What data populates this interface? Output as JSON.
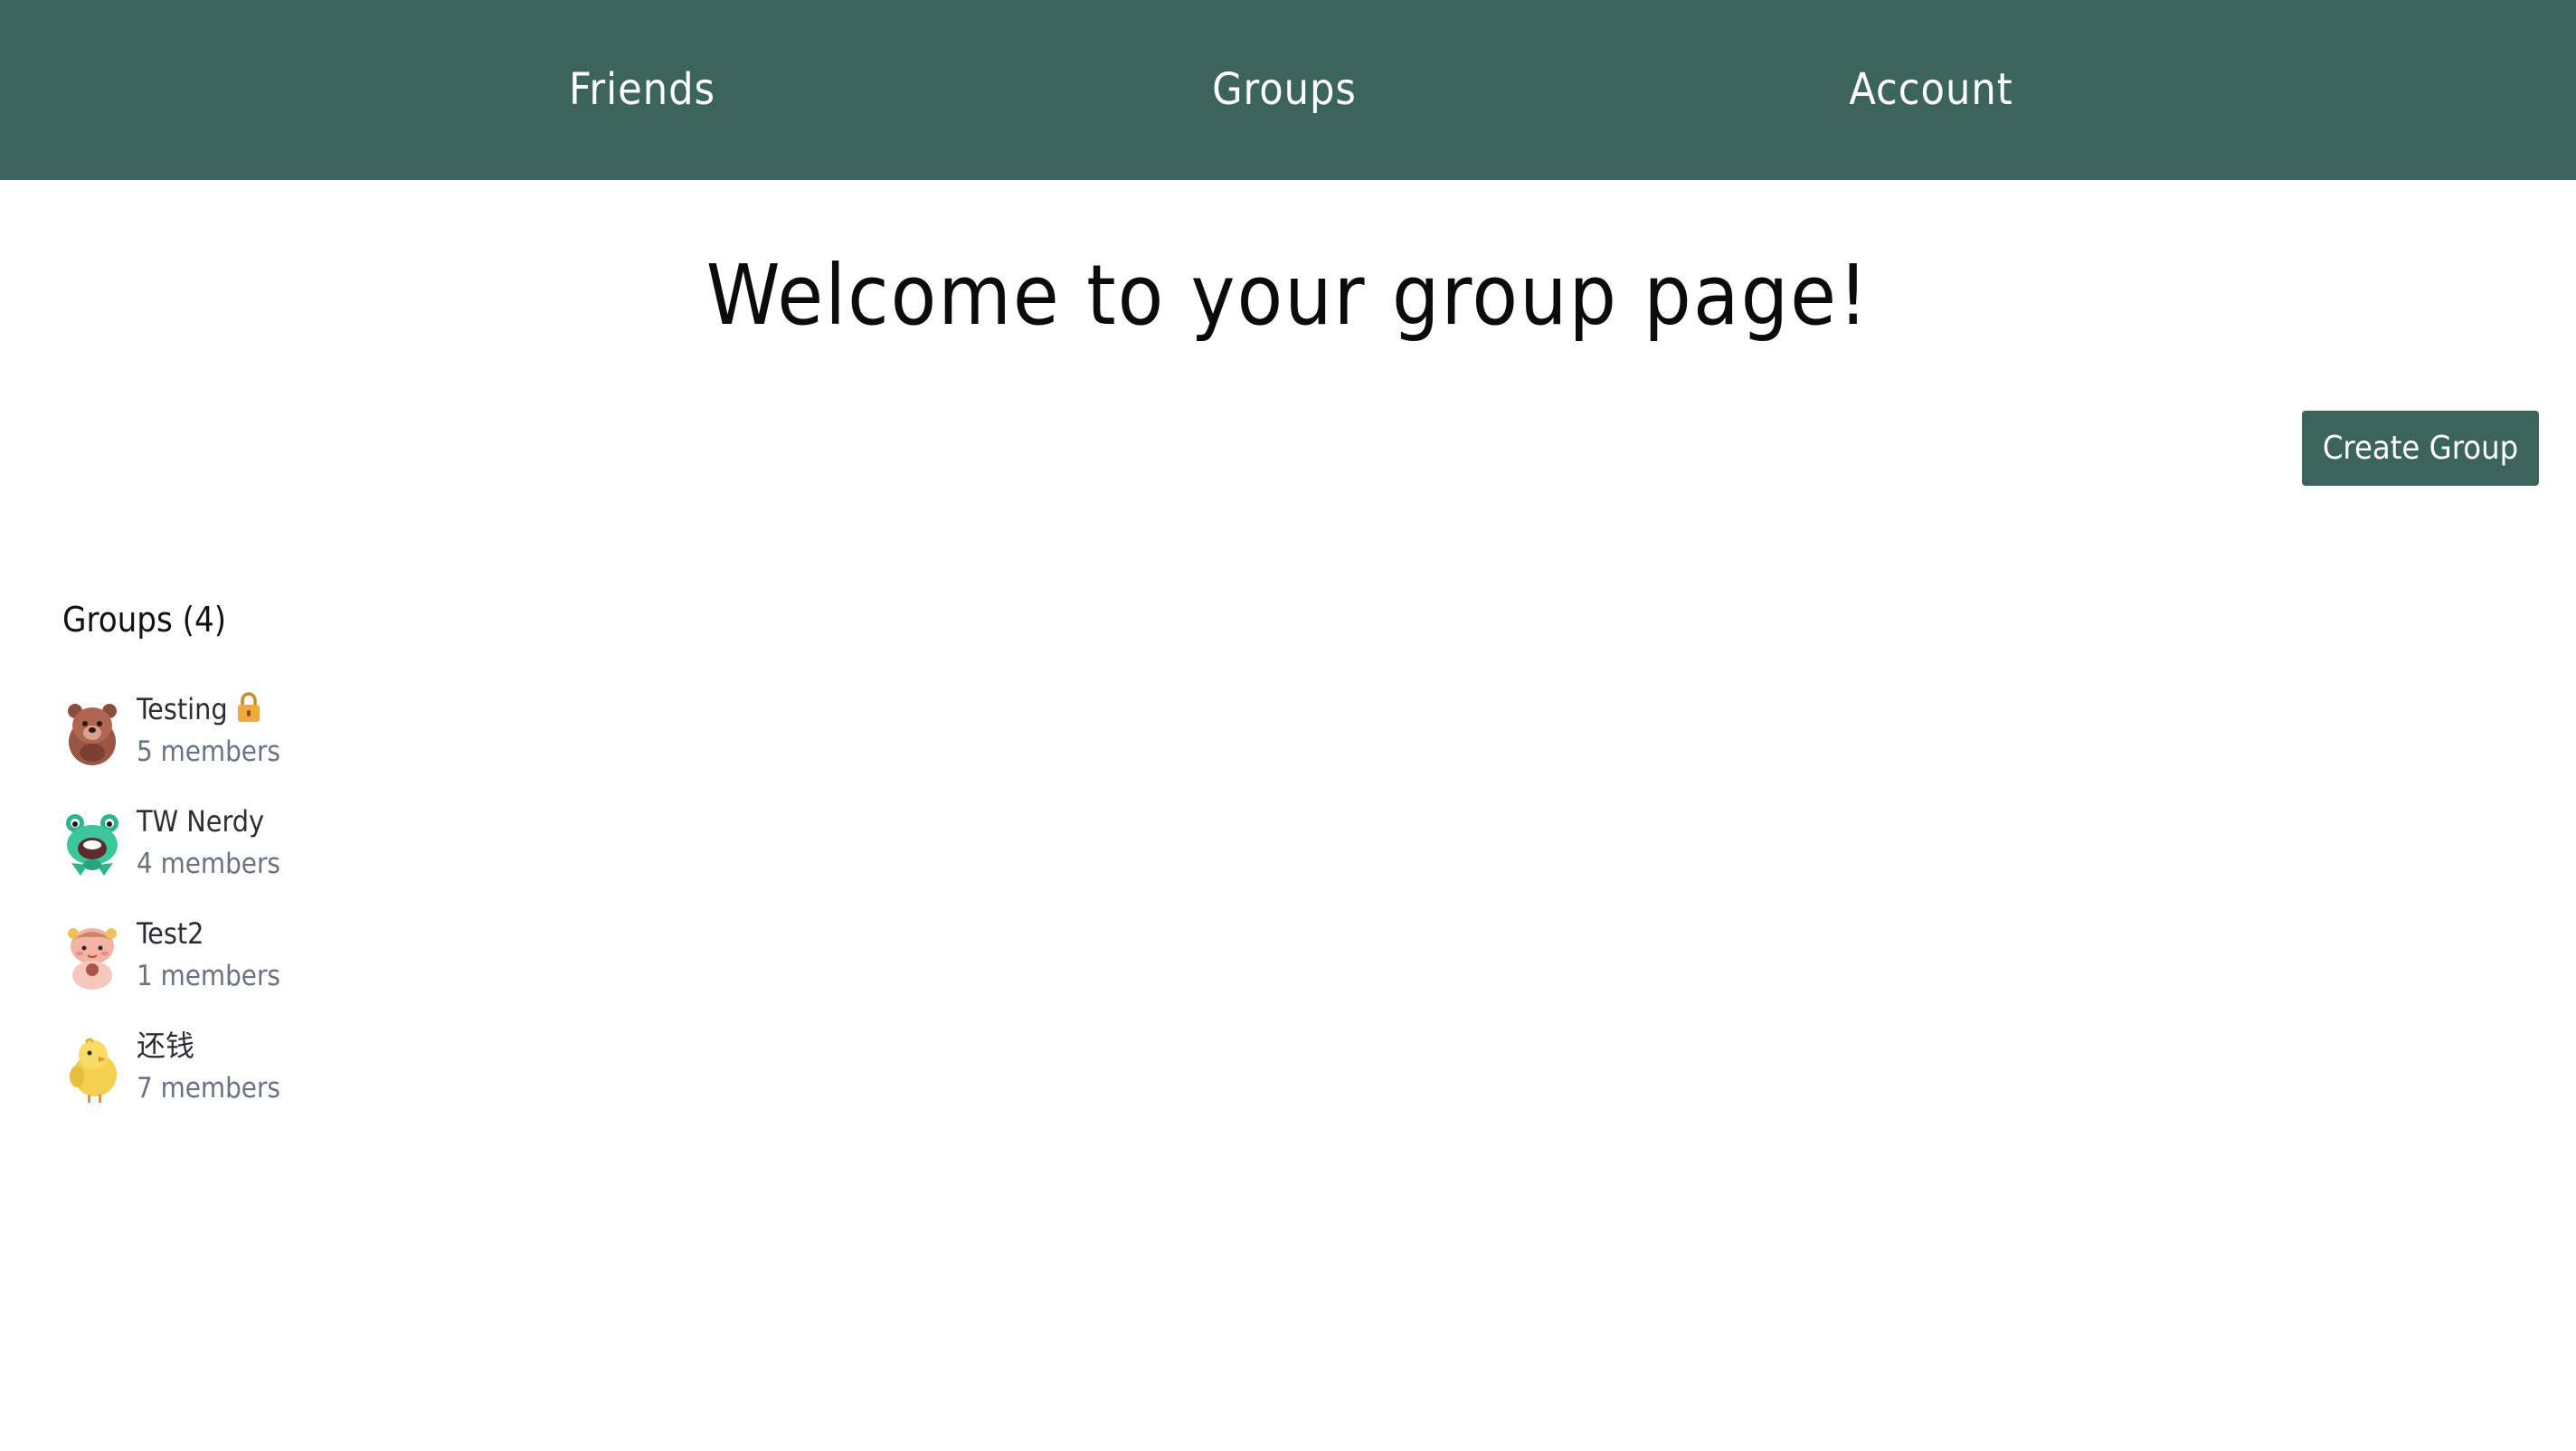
{
  "nav": {
    "friends": "Friends",
    "groups": "Groups",
    "account": "Account",
    "background": "#3c645d"
  },
  "main": {
    "title": "Welcome to your group page!",
    "create_button": "Create Group"
  },
  "groups": {
    "heading": "Groups (4)",
    "items": [
      {
        "name": "Testing",
        "members": "5 members",
        "avatar": "bear-icon",
        "locked": true
      },
      {
        "name": "TW Nerdy",
        "members": "4 members",
        "avatar": "frog-icon",
        "locked": false
      },
      {
        "name": "Test2",
        "members": "1 members",
        "avatar": "girl-icon",
        "locked": false
      },
      {
        "name": "还钱",
        "members": "7 members",
        "avatar": "chick-icon",
        "locked": false
      }
    ]
  }
}
